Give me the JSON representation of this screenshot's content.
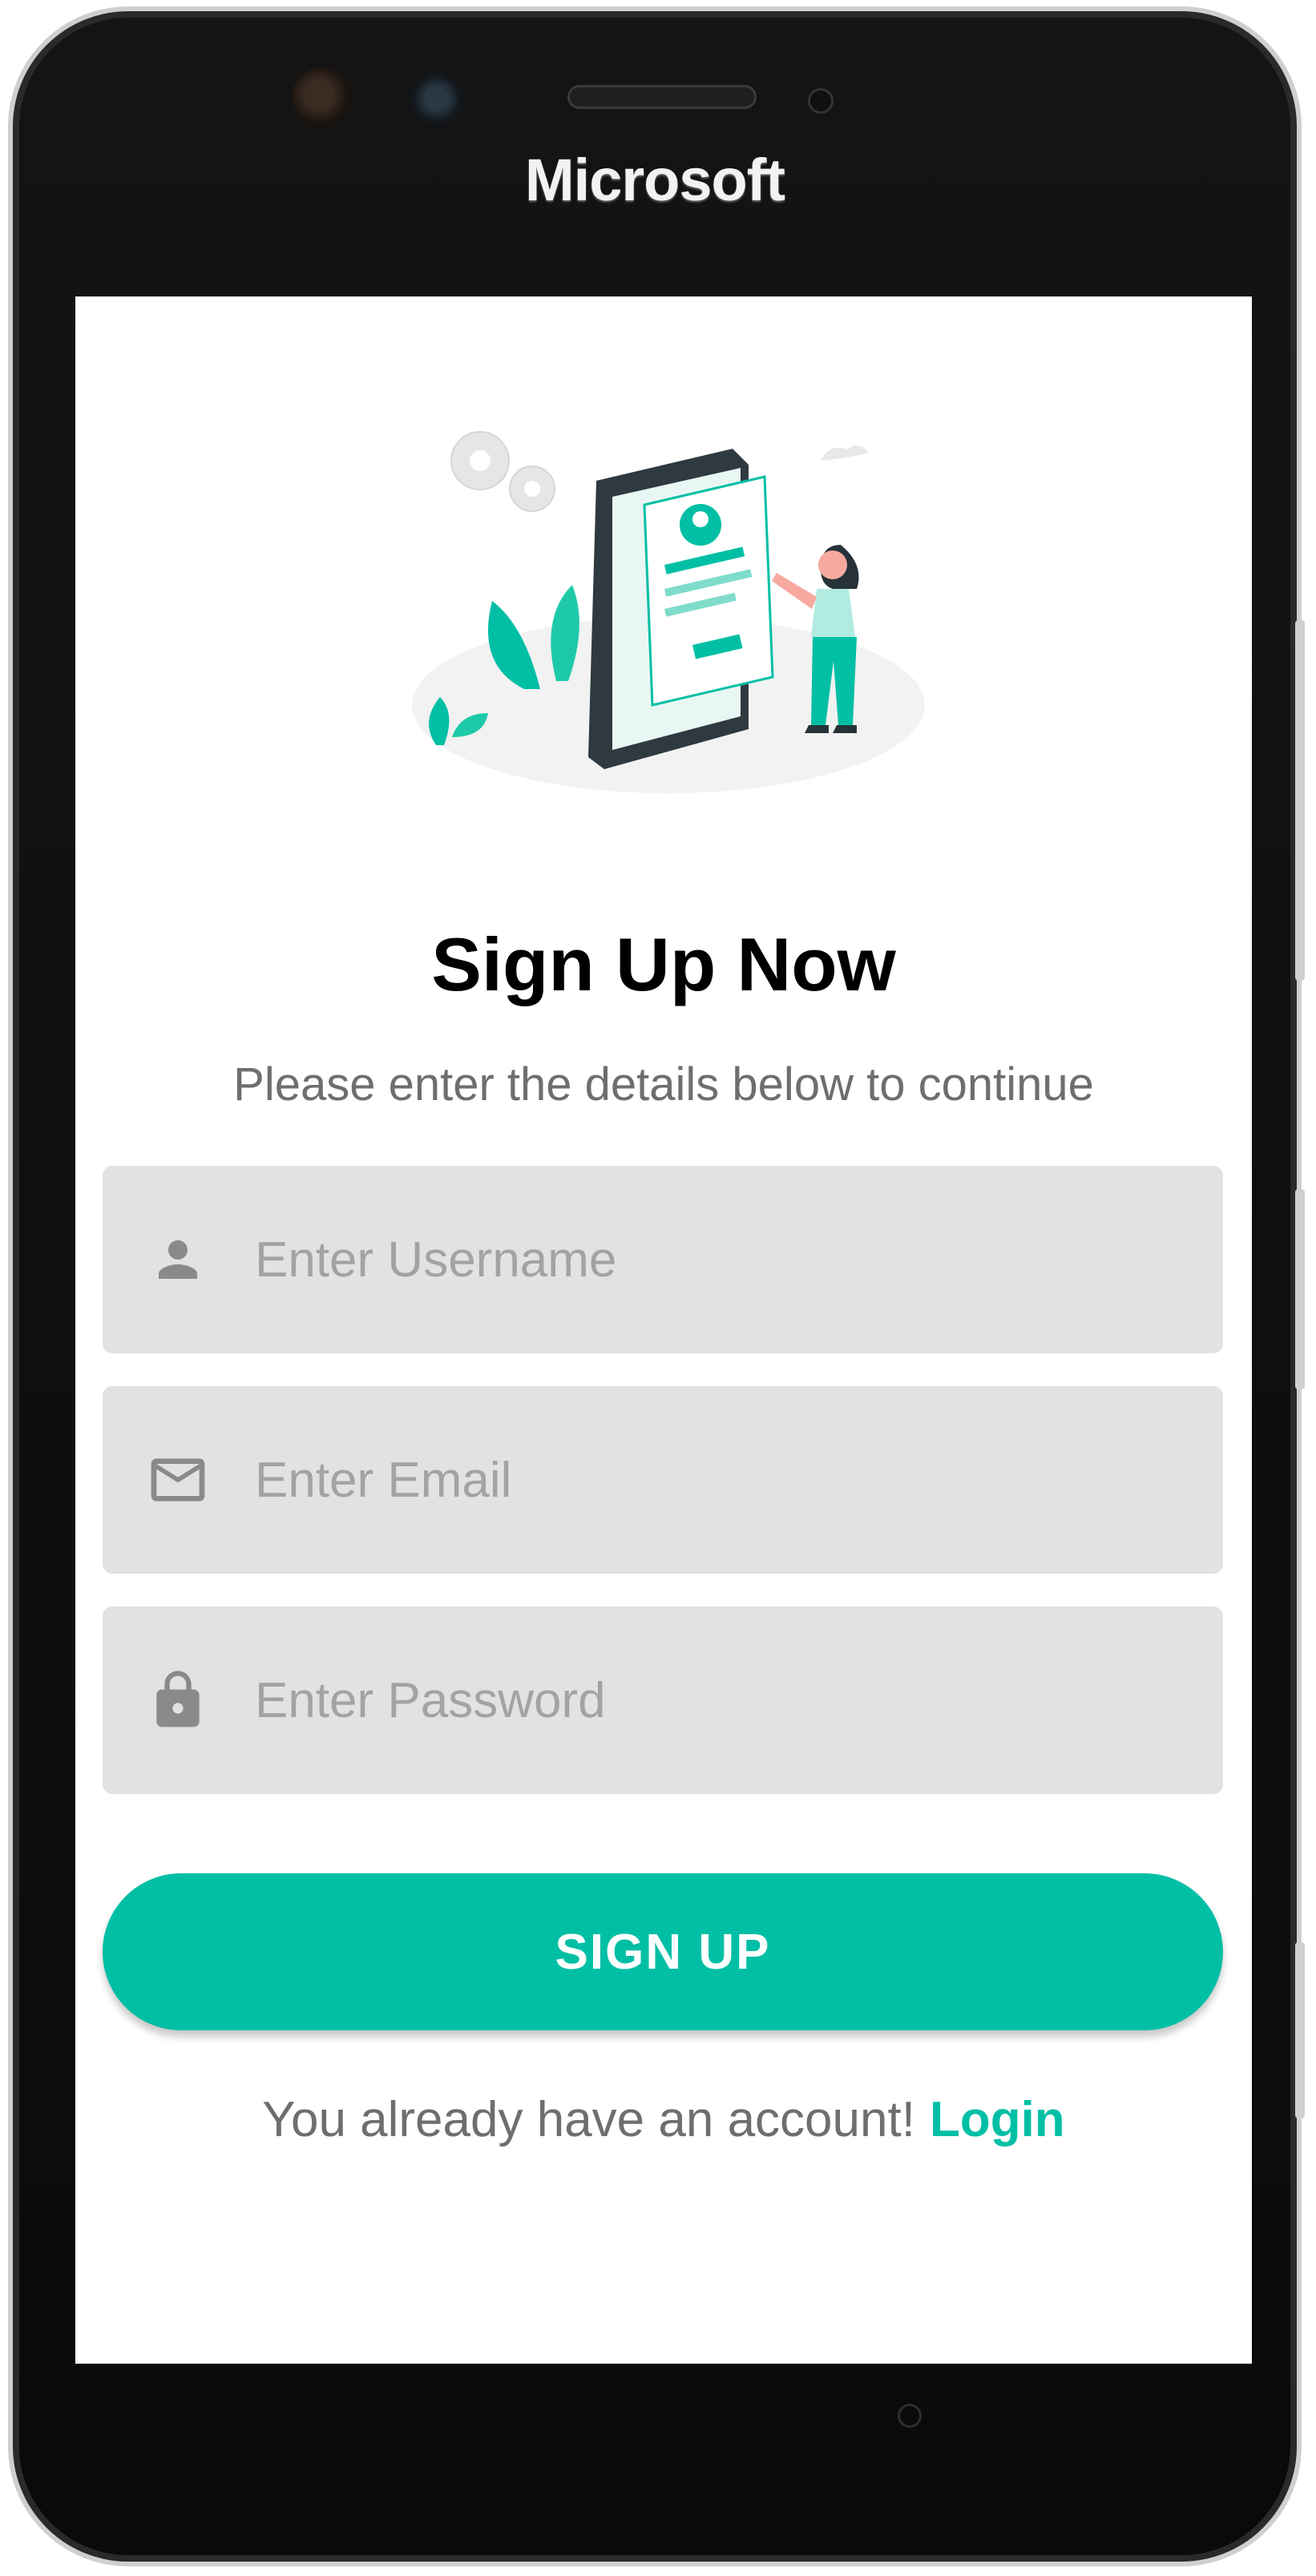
{
  "device": {
    "brand": "Microsoft"
  },
  "illustration": {
    "name": "sign-up-illustration",
    "accent_color": "#00bfa5"
  },
  "header": {
    "title": "Sign Up Now",
    "subtitle": "Please enter the details below to continue"
  },
  "form": {
    "username": {
      "placeholder": "Enter Username",
      "value": "",
      "icon": "person-icon"
    },
    "email": {
      "placeholder": "Enter Email",
      "value": "",
      "icon": "mail-icon"
    },
    "password": {
      "placeholder": "Enter Password",
      "value": "",
      "icon": "lock-icon"
    }
  },
  "actions": {
    "signup_label": "SIGN UP",
    "button_color": "#00bfa5"
  },
  "footer": {
    "prompt": "You already have an account!",
    "login_label": "Login"
  }
}
